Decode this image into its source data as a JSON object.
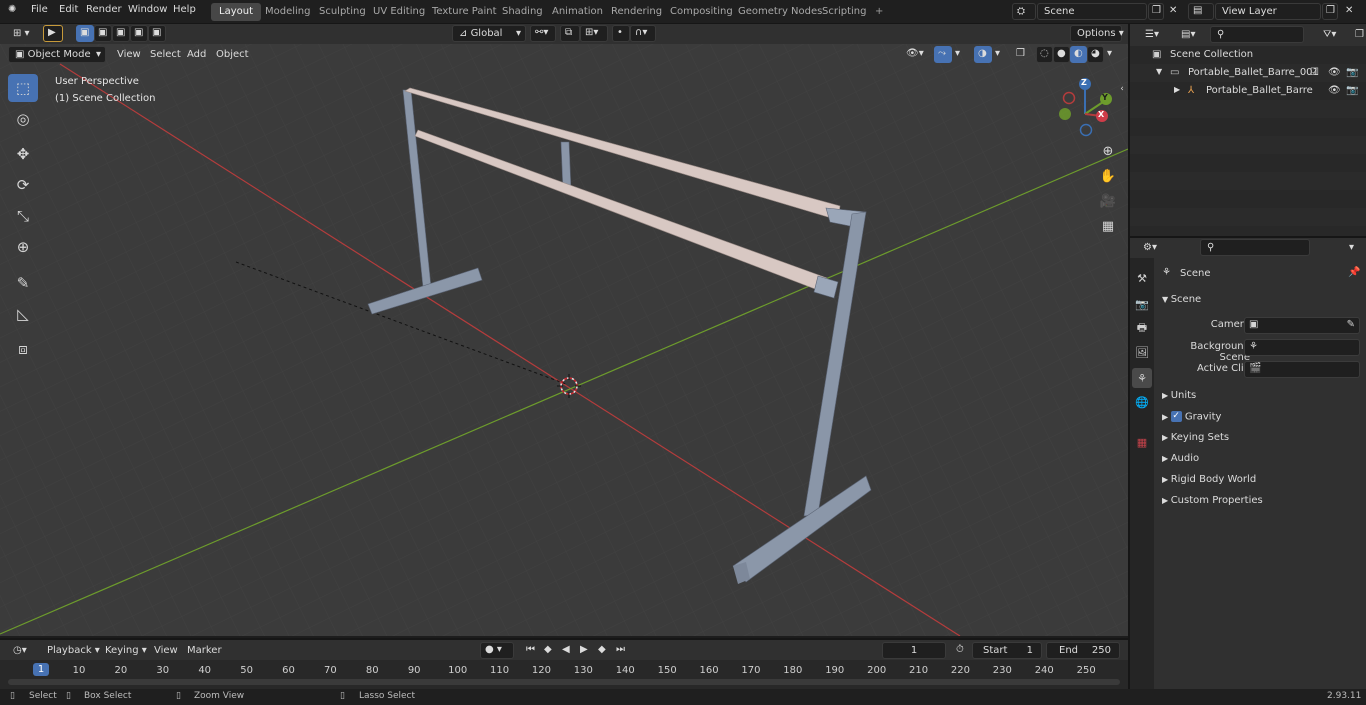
{
  "menus": [
    "File",
    "Edit",
    "Render",
    "Window",
    "Help"
  ],
  "workspaces": [
    "Layout",
    "Modeling",
    "Sculpting",
    "UV Editing",
    "Texture Paint",
    "Shading",
    "Animation",
    "Rendering",
    "Compositing",
    "Geometry Nodes",
    "Scripting"
  ],
  "active_workspace": "Layout",
  "scene_name": "Scene",
  "view_layer": "View Layer",
  "viewport": {
    "mode": "Object Mode",
    "menus": [
      "View",
      "Select",
      "Add",
      "Object"
    ],
    "transform_orientation": "Global",
    "options_label": "Options",
    "perspective_label": "User Perspective",
    "collection_label": "(1) Scene Collection",
    "gizmo_axes": [
      "Z",
      "Y",
      "X"
    ]
  },
  "outliner": {
    "root": "Scene Collection",
    "items": [
      "Portable_Ballet_Barre_001",
      "Portable_Ballet_Barre"
    ]
  },
  "properties": {
    "context_title": "Scene",
    "section": "Scene",
    "fields": [
      {
        "label": "Camera",
        "value": ""
      },
      {
        "label": "Background Scene",
        "value": ""
      },
      {
        "label": "Active Clip",
        "value": ""
      }
    ],
    "panels": [
      "Units",
      "Gravity",
      "Keying Sets",
      "Audio",
      "Rigid Body World",
      "Custom Properties"
    ],
    "gravity_checked": true
  },
  "timeline": {
    "menus": [
      "Playback",
      "Keying",
      "View",
      "Marker"
    ],
    "current_frame": "1",
    "start_label": "Start",
    "start": "1",
    "end_label": "End",
    "end": "250",
    "ruler": [
      "1",
      "10",
      "20",
      "30",
      "40",
      "50",
      "60",
      "70",
      "80",
      "90",
      "100",
      "110",
      "120",
      "130",
      "140",
      "150",
      "160",
      "170",
      "180",
      "190",
      "200",
      "210",
      "220",
      "230",
      "240",
      "250"
    ]
  },
  "status": {
    "items": [
      "Select",
      "Box Select",
      "Zoom View",
      "Lasso Select"
    ],
    "version": "2.93.11"
  },
  "colors": {
    "accent": "#4772b3",
    "x_axis": "#b43c3c",
    "y_axis": "#6d9c2c",
    "barre_rail": "#d8c8c3",
    "barre_frame": "#8a96a8"
  }
}
